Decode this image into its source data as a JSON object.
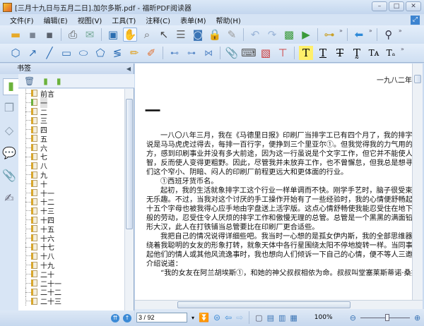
{
  "window": {
    "title": "[三月十九日与五月二日].加尔多斯.pdf - 福昕PDF阅读器",
    "controls": [
      "minimize",
      "maximize",
      "close"
    ]
  },
  "menu": [
    "文件(F)",
    "编辑(E)",
    "视图(V)",
    "工具(T)",
    "注释(C)",
    "表单(M)",
    "帮助(H)"
  ],
  "panel": {
    "title": "书签",
    "bookmarks": [
      "前言",
      "一",
      "二",
      "三",
      "四",
      "五",
      "六",
      "七",
      "八",
      "九",
      "十",
      "十一",
      "十二",
      "十三",
      "十四",
      "十五",
      "十六",
      "十七",
      "十八",
      "十九",
      "二十",
      "二十一",
      "二十二",
      "二十三"
    ],
    "selected_index": 1,
    "scroll_fraction": 0.05
  },
  "document": {
    "page_header": "一九八二年",
    "chapter": "一",
    "lines": [
      {
        "indent": true,
        "text": "一八〇八年三月，我在《马德里日报》印刷厂当排字工已有四个月了，我的排字技"
      },
      {
        "indent": false,
        "text": "说是马马虎虎过得去，每排一百行字，便挣到三个里亚尔①。但我觉得我的力气用的不"
      },
      {
        "indent": false,
        "text": "方，感到印刷事业并没有多大前途，因为这一行虽说是个文字工作，但它并不能使人增"
      },
      {
        "indent": false,
        "text": "智，反而使人变得更粗野。因此，尽管我并未放弃工作，也不曾懈怠，但我总是想寻找"
      },
      {
        "indent": false,
        "text": "们这个窄小、阴暗、闷人的印刷厂前程更远大和更体面的行业。"
      },
      {
        "indent": true,
        "text": "①西班牙货币名。"
      },
      {
        "indent": true,
        "text": "起初，我的生活就象排字工这个行业一样单调而不快。刚学手艺时，脑子很受束缚"
      },
      {
        "indent": false,
        "text": "无乐趣。不过，当我对这个讨厌的手工操作开始有了一些经验时，我的心情便舒畅起来"
      },
      {
        "indent": false,
        "text": "十五个字母也被我得心应手地由字盘送上活字版。这点心情舒畅使我能忍受住在地下室"
      },
      {
        "indent": false,
        "text": "般的劳动，忍受住令人厌烦的排字工作和傲慢无理的总管。总管是一个黑黑的满面铅粉"
      },
      {
        "indent": false,
        "text": "形大汉，此人在打铁铺当总管要比在印刷厂更合适些。"
      },
      {
        "indent": true,
        "text": "我把自己的情况说得详细些吧。我当时一心想的是孤女伊内斯，我的全部思维器官"
      },
      {
        "indent": false,
        "text": "绕着我聪明的女友的形象打转，就象天体中各行星围绕太阳不停地旋转一样。当同事们"
      },
      {
        "indent": false,
        "text": "起他们的情人或其他风流逸事时，我也想向人们倾诉一下自己的心情，便不等人三邀四"
      },
      {
        "indent": false,
        "text": "介绍说道："
      },
      {
        "indent": true,
        "text": "“我的女友在阿兰胡埃斯①，和她的神父叔叔相依为命。叔叔叫堂塞莱斯蒂诺·桑托"
      }
    ]
  },
  "status": {
    "page": "3 / 92",
    "zoom": "100%",
    "zoom_slider_fraction": 0.55
  },
  "colors": {
    "accent": "#3b8ad6",
    "chrome": "#c9daf0"
  }
}
